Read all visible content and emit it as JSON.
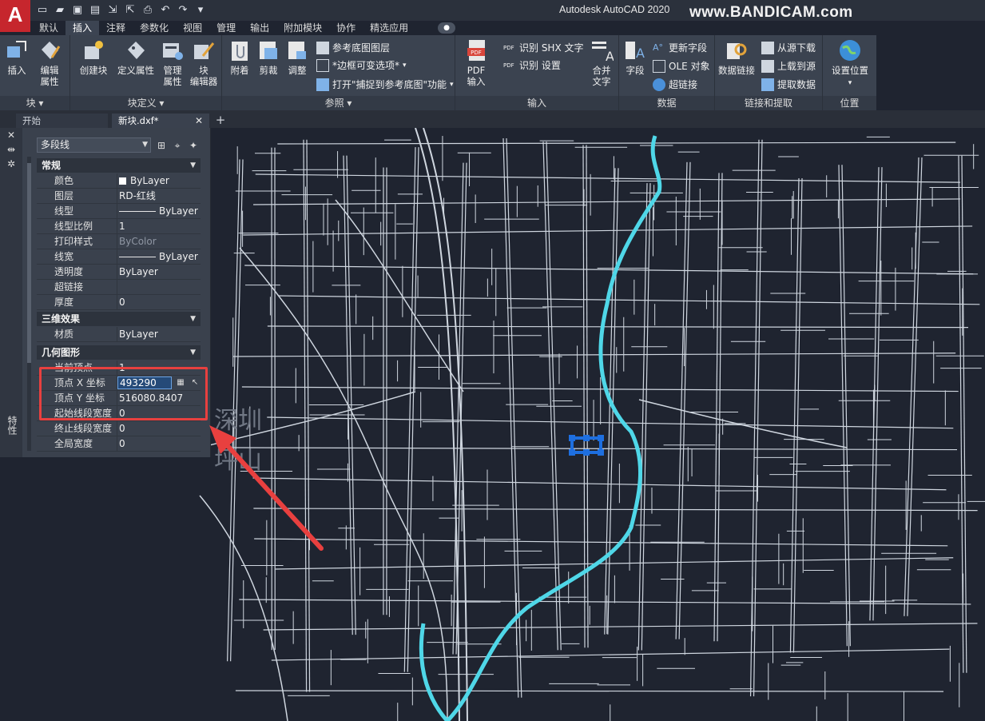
{
  "app": {
    "logo": "A",
    "window_title": "Autodesk AutoCAD 2020",
    "watermark": "www.BANDICAM.com"
  },
  "quick_access": [
    "new-icon",
    "open-icon",
    "save-icon",
    "saveas-icon",
    "import-icon",
    "export-icon",
    "plot-icon",
    "undo-icon",
    "redo-icon",
    "dropdown-icon"
  ],
  "ribbon_tabs": [
    "默认",
    "插入",
    "注释",
    "参数化",
    "视图",
    "管理",
    "输出",
    "附加模块",
    "协作",
    "精选应用"
  ],
  "ribbon_active_tab": "插入",
  "ribbon": {
    "block": {
      "title": "块",
      "insert": "插入",
      "edit_attr_1": "编辑",
      "edit_attr_2": "属性"
    },
    "block_def": {
      "title": "块定义",
      "create": "创建块",
      "define_attr": "定义属性",
      "manage_attr_1": "管理",
      "manage_attr_2": "属性",
      "block_editor_1": "块",
      "block_editor_2": "编辑器"
    },
    "reference": {
      "title": "参照",
      "attach": "附着",
      "clip": "剪裁",
      "adjust": "调整",
      "underlay_layers": "参考底图图层",
      "frame": "*边框可变选项*",
      "snap": "打开\"捕捉到参考底图\"功能"
    },
    "import": {
      "title": "输入",
      "pdf_1": "PDF",
      "pdf_2": "输入",
      "shx": "识别 SHX 文字",
      "shx_settings": "识别 设置",
      "combine_1": "合并",
      "combine_2": "文字"
    },
    "data": {
      "title": "数据",
      "field": "字段",
      "update_fields": "更新字段",
      "ole": "OLE 对象",
      "hyperlink": "超链接"
    },
    "link": {
      "title": "链接和提取",
      "data_link": "数据链接",
      "download": "从源下载",
      "upload": "上载到源",
      "extract": "提取数据"
    },
    "location": {
      "title": "位置",
      "set_location": "设置位置"
    }
  },
  "doc_tabs": {
    "start": "开始",
    "file": "新块.dxf*"
  },
  "properties": {
    "palette_label": "特性",
    "object_type": "多段线",
    "sections": {
      "general": "常规",
      "three_d": "三维效果",
      "geometry": "几何图形"
    },
    "general_rows": [
      {
        "label": "颜色",
        "value": "ByLayer"
      },
      {
        "label": "图层",
        "value": "RD-红线"
      },
      {
        "label": "线型",
        "value": "ByLayer"
      },
      {
        "label": "线型比例",
        "value": "1"
      },
      {
        "label": "打印样式",
        "value": "ByColor"
      },
      {
        "label": "线宽",
        "value": "ByLayer"
      },
      {
        "label": "透明度",
        "value": "ByLayer"
      },
      {
        "label": "超链接",
        "value": ""
      },
      {
        "label": "厚度",
        "value": "0"
      }
    ],
    "three_d_rows": [
      {
        "label": "材质",
        "value": "ByLayer"
      }
    ],
    "geometry_rows": [
      {
        "label": "当前顶点",
        "value": "1"
      },
      {
        "label": "顶点 X 坐标",
        "value": "493290"
      },
      {
        "label": "顶点 Y 坐标",
        "value": "516080.8407"
      },
      {
        "label": "起始线段宽度",
        "value": "0"
      },
      {
        "label": "终止线段宽度",
        "value": "0"
      },
      {
        "label": "全局宽度",
        "value": "0"
      }
    ]
  },
  "map_labels": {
    "city": "深圳",
    "district": "坪山"
  },
  "colors": {
    "river": "#4fd7e8",
    "roads": "#cfd6df",
    "selection": "#1e6fe0",
    "highlight": "#e8403f",
    "canvas": "#1f2430"
  }
}
